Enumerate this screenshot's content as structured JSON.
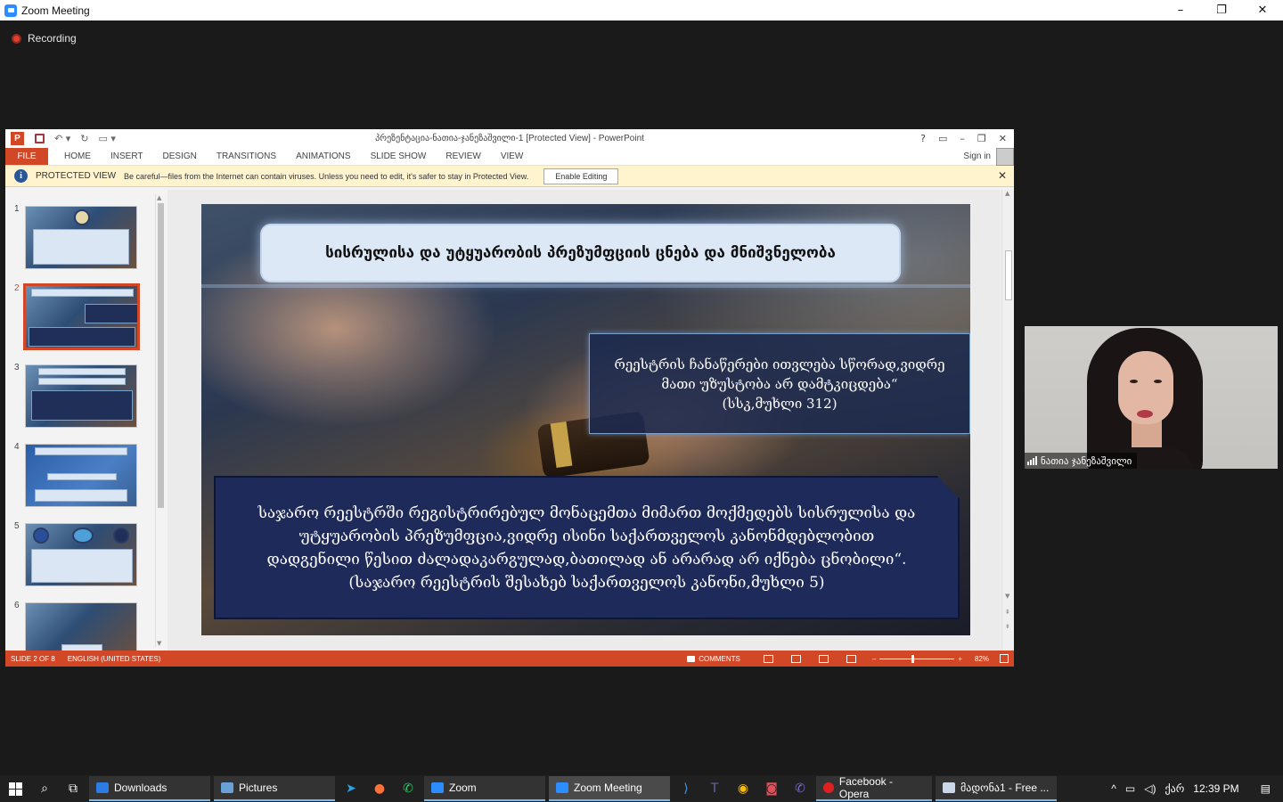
{
  "zoom": {
    "title": "Zoom Meeting",
    "recording_label": "Recording",
    "window_controls": [
      "–",
      "❐",
      "✕"
    ]
  },
  "ppt": {
    "title": "პრეზენტაცია-ნათია-ჯანეზაშვილი-1 [Protected View] - PowerPoint",
    "top_controls": [
      "?",
      "▭",
      "–",
      "❐",
      "✕"
    ],
    "tabs": {
      "file": "FILE",
      "home": "HOME",
      "insert": "INSERT",
      "design": "DESIGN",
      "transitions": "TRANSITIONS",
      "animations": "ANIMATIONS",
      "slide_show": "SLIDE SHOW",
      "review": "REVIEW",
      "view": "VIEW"
    },
    "sign_in": "Sign in",
    "protected": {
      "label": "PROTECTED VIEW",
      "message": "Be careful—files from the Internet can contain viruses. Unless you need to edit, it's safer to stay in Protected View.",
      "enable_button": "Enable Editing",
      "close": "✕"
    },
    "thumbnails": [
      "1",
      "2",
      "3",
      "4",
      "5",
      "6"
    ],
    "selected_slide": 2,
    "slide": {
      "title": "სისრულისა და უტყუარობის პრეზუმფციის ცნება და მნიშვნელობა",
      "quote_lines": [
        "რეესტრის ჩანაწერები ითვლება სწორად,ვიდრე",
        "მათი უზუსტობა არ დამტკიცდება“",
        "(სსკ,მუხლი 312)"
      ],
      "main_lines": [
        "საჯარო რეესტრში რეგისტრირებულ მონაცემთა მიმართ მოქმედებს სისრულისა და",
        "უტყუარობის პრეზუმფცია,ვიდრე ისინი საქართველოს კანონმდებლობით",
        "დადგენილი წესით ძალადაკარგულად,ბათილად ან არარად არ იქნება ცნობილი“.",
        "(საჯარო რეესტრის შესახებ საქართველოს კანონი,მუხლი 5)"
      ]
    },
    "status": {
      "slide_counter": "SLIDE 2 OF 8",
      "language": "ENGLISH (UNITED STATES)",
      "comments": "COMMENTS",
      "zoom_minus": "–",
      "zoom_plus": "+",
      "zoom_pct": "82%"
    }
  },
  "participant": {
    "name": "ნათია ჯანეზაშვილი"
  },
  "taskbar": {
    "apps": [
      {
        "label": "Downloads",
        "color": "#2d7be5"
      },
      {
        "label": "Pictures",
        "color": "#6aa0d8"
      },
      {
        "label": "Zoom",
        "color": "#2d8cff"
      },
      {
        "label": "Zoom Meeting",
        "color": "#2d8cff"
      },
      {
        "label": "Facebook - Opera",
        "color": "#e02020"
      },
      {
        "label": "მადონა1 - Free ...",
        "color": "#c9d7e8"
      }
    ],
    "tray": {
      "lang": "ქარ",
      "time": "12:39 PM"
    }
  }
}
